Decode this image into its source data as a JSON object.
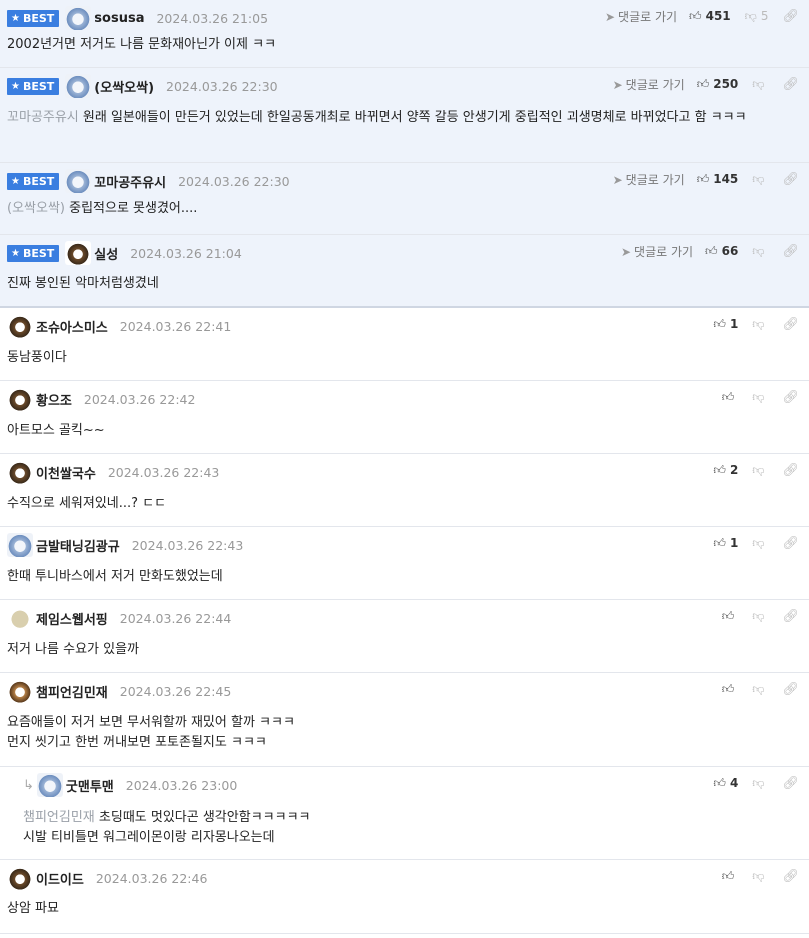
{
  "ui": {
    "best_label": "BEST",
    "goto_label": "댓글로 가기"
  },
  "comments": [
    {
      "nick": "sosusa",
      "date": "2024.03.26 21:05",
      "likes": "451",
      "dislikes": "5",
      "text": "2002년거면 저거도 나름 문화재아닌가 이제 ㅋㅋ",
      "mention": "",
      "best": true,
      "avatar": "bear"
    },
    {
      "nick": "(오싹오싹)",
      "date": "2024.03.26 22:30",
      "likes": "250",
      "dislikes": "",
      "text": "원래 일본애들이 만든거 있었는데 한일공동개최로 바뀌면서 양쪽 갈등 안생기게 중립적인 괴생명체로 바뀌었다고 함 ㅋㅋㅋ",
      "mention": "꼬마공주유시",
      "best": true,
      "avatar": "bear"
    },
    {
      "nick": "꼬마공주유시",
      "date": "2024.03.26 22:30",
      "likes": "145",
      "dislikes": "",
      "text": "중립적으로 못생겼어....",
      "mention": "(오싹오싹)",
      "best": true,
      "avatar": "bear"
    },
    {
      "nick": "실성",
      "date": "2024.03.26 21:04",
      "likes": "66",
      "dislikes": "",
      "text": "진짜 봉인된 악마처럼생겼네",
      "mention": "",
      "best": true,
      "avatar": "dog"
    },
    {
      "nick": "조슈아스미스",
      "date": "2024.03.26 22:41",
      "likes": "1",
      "dislikes": "",
      "text": "동남풍이다",
      "mention": "",
      "best": false,
      "avatar": "dog"
    },
    {
      "nick": "황으조",
      "date": "2024.03.26 22:42",
      "likes": "",
      "dislikes": "",
      "text": "아트모스 골킥~~",
      "mention": "",
      "best": false,
      "avatar": "dog"
    },
    {
      "nick": "이천쌀국수",
      "date": "2024.03.26 22:43",
      "likes": "2",
      "dislikes": "",
      "text": "수직으로 세워져있네...? ㄷㄷ",
      "mention": "",
      "best": false,
      "avatar": "dog"
    },
    {
      "nick": "금발태닝김광규",
      "date": "2024.03.26 22:43",
      "likes": "1",
      "dislikes": "",
      "text": "한때 투니바스에서 저거 만화도했었는데",
      "mention": "",
      "best": false,
      "avatar": "bear"
    },
    {
      "nick": "제임스웹서핑",
      "date": "2024.03.26 22:44",
      "likes": "",
      "dislikes": "",
      "text": "저거 나름 수요가 있을까",
      "mention": "",
      "best": false,
      "avatar": "round"
    },
    {
      "nick": "챔피언김민재",
      "date": "2024.03.26 22:45",
      "likes": "",
      "dislikes": "",
      "text": "요즘애들이 저거 보면 무서워할까 재밌어 할까 ㅋㅋㅋ",
      "text2": "먼지 씻기고 한번 꺼내보면 포토존될지도 ㅋㅋㅋ",
      "mention": "",
      "best": false,
      "avatar": "fox"
    },
    {
      "nick": "굿맨투맨",
      "date": "2024.03.26 23:00",
      "likes": "4",
      "dislikes": "",
      "text": "초딩때도 멋있다곤 생각안함ㅋㅋㅋㅋㅋ",
      "text2": "시발 티비틀면 워그레이몬이랑 리자몽나오는데",
      "mention": "챔피언김민재",
      "best": false,
      "reply": true,
      "avatar": "bear"
    },
    {
      "nick": "이드이드",
      "date": "2024.03.26 22:46",
      "likes": "",
      "dislikes": "",
      "text": "상암 파묘",
      "mention": "",
      "best": false,
      "avatar": "dog"
    }
  ]
}
